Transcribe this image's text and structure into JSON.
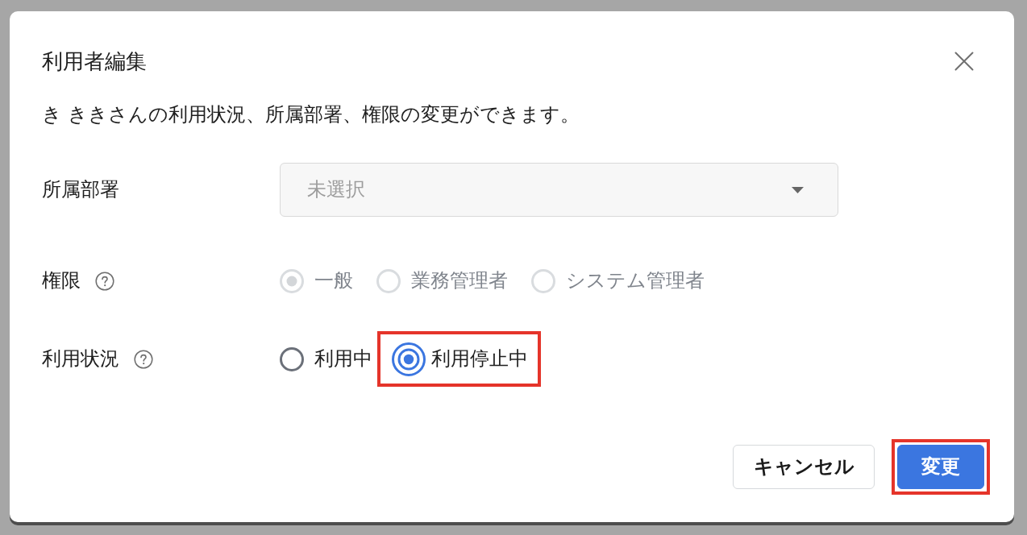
{
  "dialog": {
    "title": "利用者編集",
    "description": "き ききさんの利用状況、所属部署、権限の変更ができます。"
  },
  "fields": [
    {
      "kind": "select",
      "label": "所属部署",
      "help": false,
      "placeholder": "未選択"
    },
    {
      "kind": "radio",
      "label": "権限",
      "help": true,
      "disabled": true,
      "options": [
        {
          "label": "一般",
          "selected": true,
          "highlighted": false
        },
        {
          "label": "業務管理者",
          "selected": false,
          "highlighted": false
        },
        {
          "label": "システム管理者",
          "selected": false,
          "highlighted": false
        }
      ]
    },
    {
      "kind": "radio",
      "label": "利用状況",
      "help": true,
      "disabled": false,
      "options": [
        {
          "label": "利用中",
          "selected": false,
          "highlighted": false
        },
        {
          "label": "利用停止中",
          "selected": true,
          "highlighted": true
        }
      ]
    }
  ],
  "buttons": [
    {
      "kind": "secondary",
      "label": "キャンセル",
      "highlighted": false
    },
    {
      "kind": "primary",
      "label": "変更",
      "highlighted": true
    }
  ]
}
